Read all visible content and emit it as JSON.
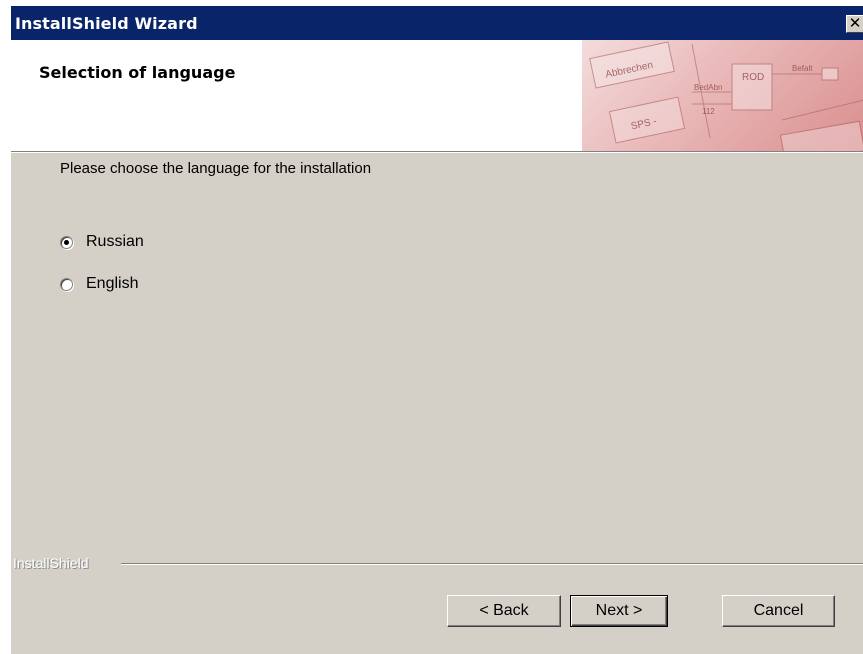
{
  "window": {
    "title": "InstallShield Wizard",
    "close_glyph": "✕"
  },
  "header": {
    "title": "Selection of language",
    "art": {
      "button_1": "Abbrechen",
      "button_2": "SPS -",
      "box_label": "ROD",
      "label_a": "BedAbn",
      "label_b": "112",
      "label_c": "Befalt"
    }
  },
  "body": {
    "prompt": "Please choose the language for the installation",
    "options": [
      {
        "label": "Russian",
        "checked": true
      },
      {
        "label": "English",
        "checked": false
      }
    ]
  },
  "footer": {
    "brand": "InstallShield",
    "buttons": {
      "back": "< Back",
      "next": "Next >",
      "cancel": "Cancel"
    }
  },
  "colors": {
    "titlebar": "#0a246a",
    "face": "#d4d0c8",
    "header_bg": "#ffffff"
  },
  "icons": {
    "close": "close-icon"
  }
}
